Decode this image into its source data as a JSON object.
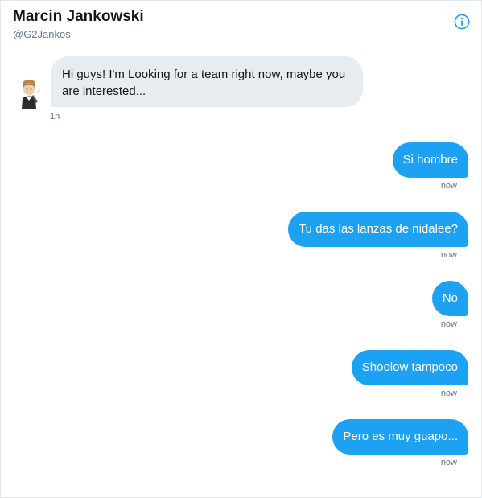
{
  "header": {
    "name": "Marcin Jankowski",
    "handle": "@G2Jankos",
    "info_icon": "info-circle-icon"
  },
  "colors": {
    "accent": "#1da1f2",
    "incoming_bg": "#e6ecf0",
    "muted": "#657786"
  },
  "messages": [
    {
      "direction": "incoming",
      "text": "Hi guys! I'm Looking for a team right now, maybe you are interested...",
      "time": "1h"
    },
    {
      "direction": "outgoing",
      "text": "Si hombre",
      "time": "now"
    },
    {
      "direction": "outgoing",
      "text": "Tu das las lanzas de nidalee?",
      "time": "now"
    },
    {
      "direction": "outgoing",
      "text": "No",
      "time": "now"
    },
    {
      "direction": "outgoing",
      "text": "Shoolow tampoco",
      "time": "now"
    },
    {
      "direction": "outgoing",
      "text": "Pero es muy guapo...",
      "time": "now"
    }
  ]
}
